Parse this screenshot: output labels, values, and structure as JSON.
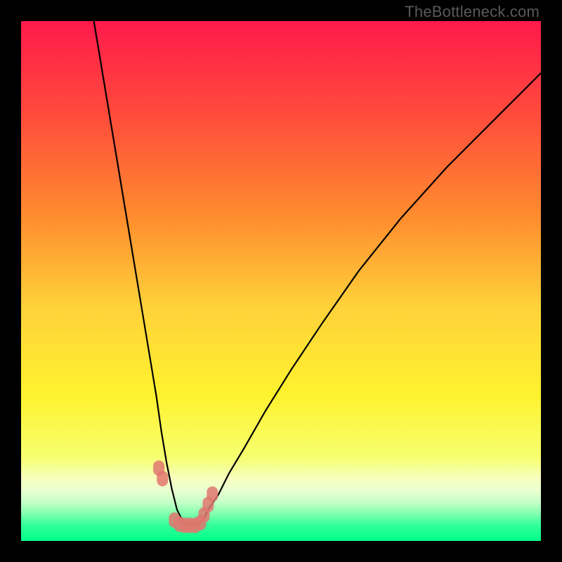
{
  "watermark": "TheBottleneck.com",
  "chart_data": {
    "type": "line",
    "title": "",
    "xlabel": "",
    "ylabel": "",
    "xlim": [
      0,
      100
    ],
    "ylim": [
      0,
      100
    ],
    "grid": false,
    "legend": false,
    "annotations": [],
    "background_gradient_stops": [
      {
        "pct": 0,
        "color": "#ff1a4b"
      },
      {
        "pct": 18,
        "color": "#ff4b3c"
      },
      {
        "pct": 38,
        "color": "#ff8e2e"
      },
      {
        "pct": 55,
        "color": "#ffd23a"
      },
      {
        "pct": 72,
        "color": "#fff22e"
      },
      {
        "pct": 84,
        "color": "#f6ff70"
      },
      {
        "pct": 88,
        "color": "#f7ffc0"
      },
      {
        "pct": 90.5,
        "color": "#e8ffd0"
      },
      {
        "pct": 92.5,
        "color": "#c6ffc8"
      },
      {
        "pct": 94.5,
        "color": "#8affb0"
      },
      {
        "pct": 97,
        "color": "#32ff9a"
      },
      {
        "pct": 100,
        "color": "#00ff88"
      }
    ],
    "series": [
      {
        "name": "bottleneck-curve",
        "color": "#000000",
        "x": [
          14,
          16,
          18,
          20,
          22,
          24,
          26,
          27,
          28,
          29,
          30,
          31,
          32,
          33,
          34,
          35,
          36,
          38,
          40,
          43,
          47,
          52,
          58,
          65,
          73,
          82,
          92,
          100
        ],
        "y": [
          100,
          88,
          76,
          64,
          52,
          40,
          28,
          21,
          15,
          10,
          6,
          4,
          3,
          3,
          3,
          4,
          6,
          9,
          13,
          18,
          25,
          33,
          42,
          52,
          62,
          72,
          82,
          90
        ]
      },
      {
        "name": "highlight-markers",
        "color": "#e0776e",
        "x": [
          26.5,
          27.2,
          29.5,
          30.5,
          31.5,
          32.5,
          33.5,
          34.5,
          35.2,
          36.0,
          36.8
        ],
        "y": [
          14.0,
          12.0,
          4.0,
          3.2,
          3.0,
          3.0,
          3.0,
          3.5,
          5.0,
          7.0,
          9.0
        ]
      }
    ]
  }
}
